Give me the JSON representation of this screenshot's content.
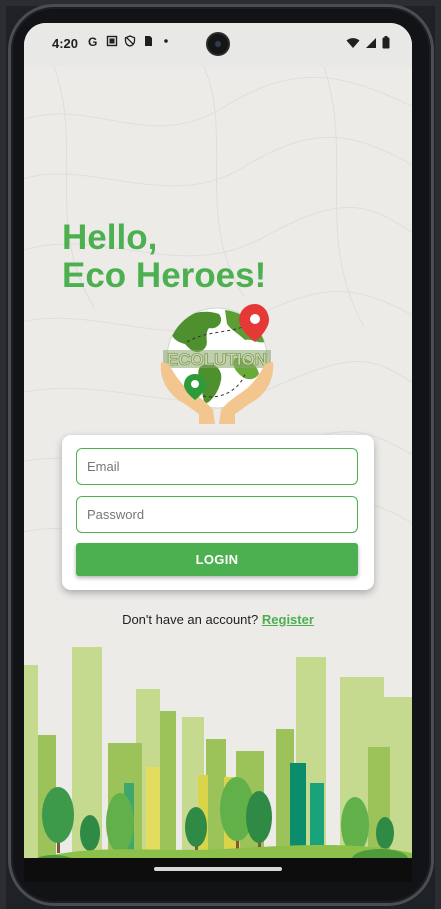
{
  "status_bar": {
    "time": "4:20",
    "left_icons": [
      "g-icon",
      "screenshot-icon",
      "shield-icon",
      "sim-card-icon",
      "dot-icon"
    ],
    "right_icons": [
      "wifi-icon",
      "signal-icon",
      "battery-icon"
    ]
  },
  "greeting": {
    "line1": "Hello,",
    "line2": "Eco Heroes!"
  },
  "logo": {
    "text": "ECOLUTION"
  },
  "login_form": {
    "email_placeholder": "Email",
    "password_placeholder": "Password",
    "login_label": "LOGIN"
  },
  "register": {
    "prompt": "Don't have an account?",
    "link": "Register"
  },
  "colors": {
    "accent": "#4caf50",
    "background": "#ecebe8",
    "pin_red": "#e53935",
    "pin_green": "#2e9b3a",
    "hands": "#f2c68e"
  }
}
